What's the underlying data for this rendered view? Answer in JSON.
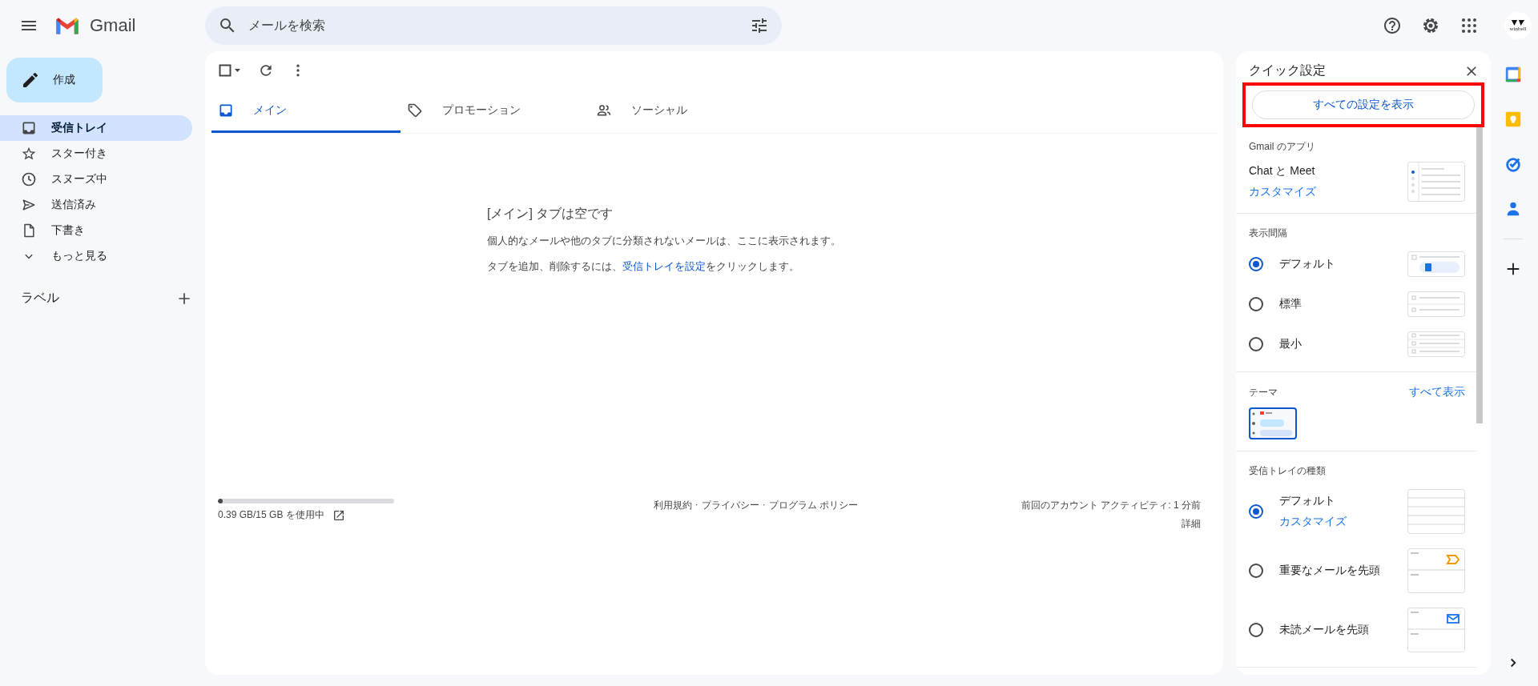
{
  "header": {
    "app_name": "Gmail",
    "search": {
      "placeholder": "メールを検索"
    },
    "avatar_text": "winbell"
  },
  "compose": {
    "label": "作成"
  },
  "toolbar": {
    "select_all": {
      "checked": false
    }
  },
  "nav": [
    {
      "label": "受信トレイ",
      "kind": "inbox",
      "selected": true
    },
    {
      "label": "スター付き",
      "kind": "star",
      "selected": false
    },
    {
      "label": "スヌーズ中",
      "kind": "clock",
      "selected": false
    },
    {
      "label": "送信済み",
      "kind": "send",
      "selected": false
    },
    {
      "label": "下書き",
      "kind": "draft",
      "selected": false
    },
    {
      "label": "もっと見る",
      "kind": "chevron",
      "selected": false
    }
  ],
  "labels_heading": "ラベル",
  "tabs": [
    {
      "label": "メイン",
      "kind": "inbox",
      "selected": true
    },
    {
      "label": "プロモーション",
      "kind": "tag",
      "selected": false
    },
    {
      "label": "ソーシャル",
      "kind": "people",
      "selected": false
    }
  ],
  "empty_state": {
    "title": "[メイン] タブは空です",
    "body": "個人的なメールや他のタブに分類されないメールは、ここに表示されます。",
    "hint_before": "タブを追加、削除するには、",
    "hint_link": "受信トレイを設定",
    "hint_after": "をクリックします。"
  },
  "footer": {
    "storage": {
      "level": 0.026,
      "text": "0.39 GB/15 GB を使用中"
    },
    "links": [
      "利用規約",
      "プライバシー",
      "プログラム ポリシー"
    ],
    "link_separator": "·",
    "activity": "前回のアカウント アクティビティ: 1 分前",
    "details": "詳細"
  },
  "quick_settings": {
    "title": "クイック設定",
    "all_settings_button": {
      "label": "すべての設定を表示",
      "highlighted": true
    },
    "apps": {
      "heading": "Gmail のアプリ",
      "name": "Chat と Meet",
      "link": "カスタマイズ"
    },
    "density": {
      "heading": "表示間隔",
      "options": [
        {
          "label": "デフォルト",
          "kind": "default",
          "selected": true
        },
        {
          "label": "標準",
          "kind": "comfortable",
          "selected": false
        },
        {
          "label": "最小",
          "kind": "compact",
          "selected": false
        }
      ]
    },
    "theme": {
      "heading": "テーマ",
      "link": "すべて表示",
      "selected": true
    },
    "inbox_type": {
      "heading": "受信トレイの種類",
      "options": [
        {
          "label": "デフォルト",
          "link": "カスタマイズ",
          "kind": "default",
          "selected": true
        },
        {
          "label": "重要なメールを先頭",
          "kind": "important",
          "selected": false
        },
        {
          "label": "未読メールを先頭",
          "kind": "unread",
          "selected": false
        }
      ]
    }
  }
}
